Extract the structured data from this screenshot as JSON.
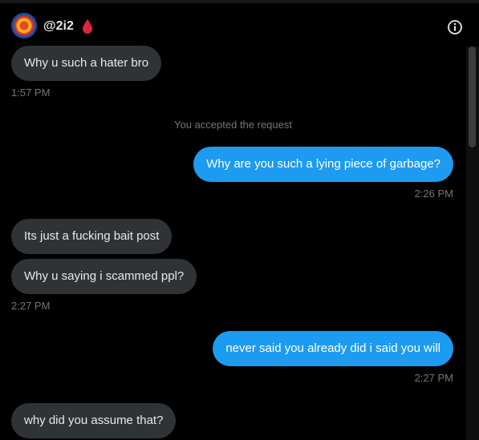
{
  "header": {
    "handle": "@2i2",
    "badge_icon": "blood-drop-icon",
    "info_icon": "info-icon",
    "avatar_icon": "avatar"
  },
  "colors": {
    "sent_bubble": "#1d9bf0",
    "received_bubble": "#2f3336",
    "timestamp": "#71767b",
    "drop": "#e0243d"
  },
  "messages": [
    {
      "direction": "received",
      "text": "Why u such a hater bro"
    },
    {
      "time": "1:57 PM"
    },
    {
      "system": "You accepted the request"
    },
    {
      "direction": "sent",
      "text": "Why are you such a lying piece of garbage?"
    },
    {
      "time": "2:26 PM"
    },
    {
      "direction": "received",
      "text": "Its just a fucking bait post"
    },
    {
      "direction": "received",
      "text": "Why u saying i scammed ppl?"
    },
    {
      "time": "2:27 PM"
    },
    {
      "direction": "sent",
      "text": "never said you already did i said you will"
    },
    {
      "time": "2:27 PM"
    },
    {
      "direction": "received",
      "text": "why did you assume that?"
    }
  ]
}
